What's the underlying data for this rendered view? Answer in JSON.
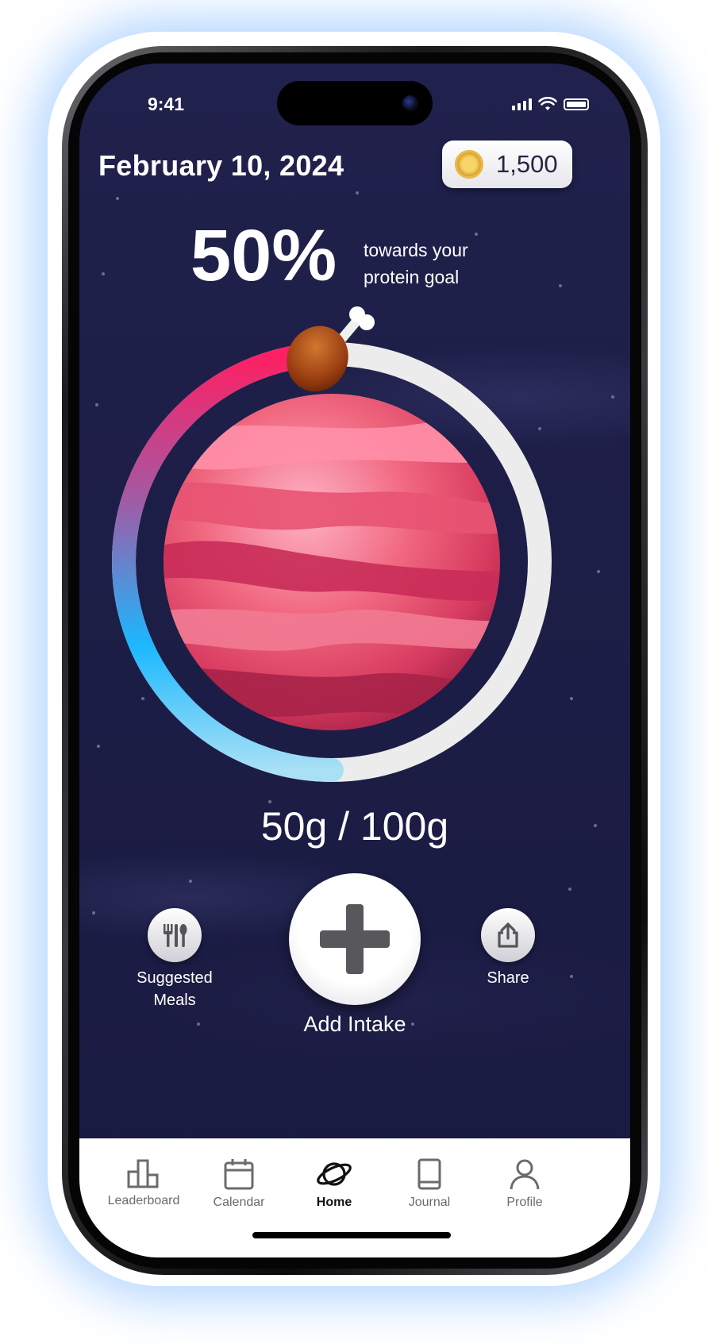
{
  "status_bar": {
    "time": "9:41"
  },
  "header": {
    "date": "February 10, 2024",
    "coins": "1,500",
    "coin_icon": "coin-icon"
  },
  "progress": {
    "percent_label": "50%",
    "caption_line1": "towards your",
    "caption_line2": "protein goal",
    "fraction": 0.5,
    "amount_label": "50g / 100g",
    "gradient_colors": [
      "#f0135f",
      "#1ec0ff",
      "#a8dff5"
    ],
    "track_color": "#ececec"
  },
  "actions": {
    "suggested": {
      "label_line1": "Suggested",
      "label_line2": "Meals",
      "icon": "utensils-icon"
    },
    "add": {
      "label": "Add Intake",
      "icon": "plus-icon"
    },
    "share": {
      "label": "Share",
      "icon": "share-icon"
    }
  },
  "tabbar": {
    "items": [
      {
        "label": "Leaderboard",
        "icon": "leaderboard-icon",
        "active": false
      },
      {
        "label": "Calendar",
        "icon": "calendar-icon",
        "active": false
      },
      {
        "label": "Home",
        "icon": "planet-icon",
        "active": true
      },
      {
        "label": "Journal",
        "icon": "book-icon",
        "active": false
      },
      {
        "label": "Profile",
        "icon": "person-icon",
        "active": false
      }
    ]
  }
}
